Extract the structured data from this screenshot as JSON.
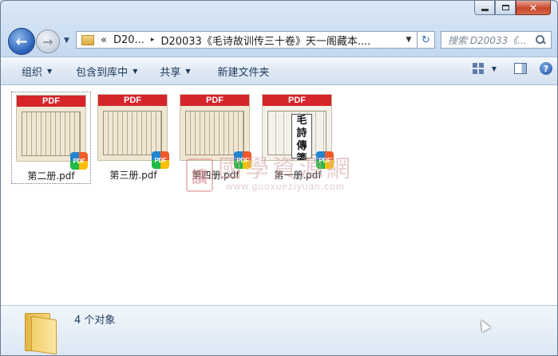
{
  "window": {
    "caption": {
      "min_icon": "minimize-icon",
      "max_icon": "maximize-icon",
      "close_glyph": "✕"
    }
  },
  "nav": {
    "back_glyph": "←",
    "forward_glyph": "→",
    "recent_glyph": "▼",
    "address": {
      "overflow": "«",
      "crumbs": [
        "D20...",
        "D20033《毛诗故训传三十卷》天一阁藏本...."
      ],
      "separator": "▸",
      "dropdown": "▼"
    },
    "refresh_glyph": "↻",
    "search_placeholder": "搜索 D20033《..."
  },
  "toolbar": {
    "organize": "组织",
    "include_in_library": "包含到库中",
    "share": "共享",
    "new_folder": "新建文件夹",
    "caret": "▼"
  },
  "files": [
    {
      "name": "第二册.pdf",
      "band": "PDF",
      "badge": "PDF",
      "selected": true,
      "cover": false
    },
    {
      "name": "第三册.pdf",
      "band": "PDF",
      "badge": "PDF",
      "selected": false,
      "cover": false
    },
    {
      "name": "第四册.pdf",
      "band": "PDF",
      "badge": "PDF",
      "selected": false,
      "cover": false
    },
    {
      "name": "第一册.pdf",
      "band": "PDF",
      "badge": "PDF",
      "selected": false,
      "cover": true,
      "cover_title": "毛詩傳箋"
    }
  ],
  "watermark": {
    "seal": "讀",
    "title": "國學資源網",
    "url": "www.guoxueziyuan.com"
  },
  "details": {
    "count_text": "4 个对象"
  },
  "colors": {
    "pdf_band": "#d6242b",
    "toolbar_text": "#1e395b",
    "close_button": "#c7462b"
  }
}
